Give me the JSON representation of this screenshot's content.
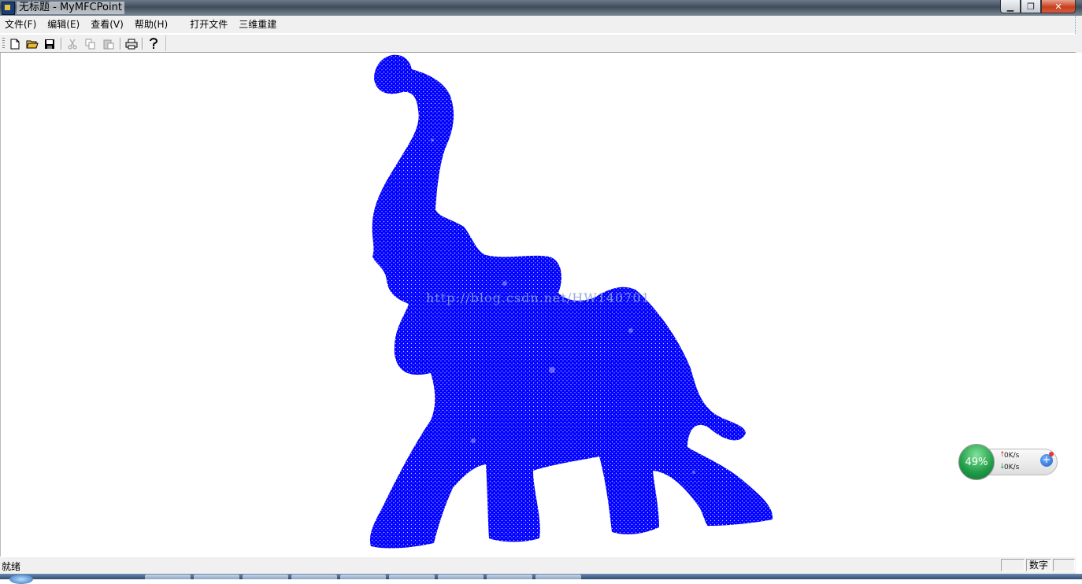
{
  "window": {
    "title": "无标题 - MyMFCPoint",
    "controls": [
      "minimize-icon",
      "restore-icon",
      "close-icon"
    ]
  },
  "menu": {
    "items": [
      "文件(F)",
      "编辑(E)",
      "查看(V)",
      "帮助(H)",
      "打开文件",
      "三维重建"
    ]
  },
  "toolbar": {
    "buttons": [
      "new-file-icon",
      "open-folder-icon",
      "save-icon",
      "cut-icon",
      "copy-icon",
      "paste-icon",
      "print-icon",
      "help-icon"
    ]
  },
  "canvas": {
    "point_color": "#0000ff",
    "watermark": "http://blog.csdn.net/HW140701"
  },
  "net_widget": {
    "percent": "49%",
    "upload": "0K/s",
    "download": "0K/s"
  },
  "status": {
    "text": "就绪",
    "num_indicator": "数字"
  },
  "colors": {
    "accent": "#0000ff",
    "chrome": "#f0f0f0"
  }
}
